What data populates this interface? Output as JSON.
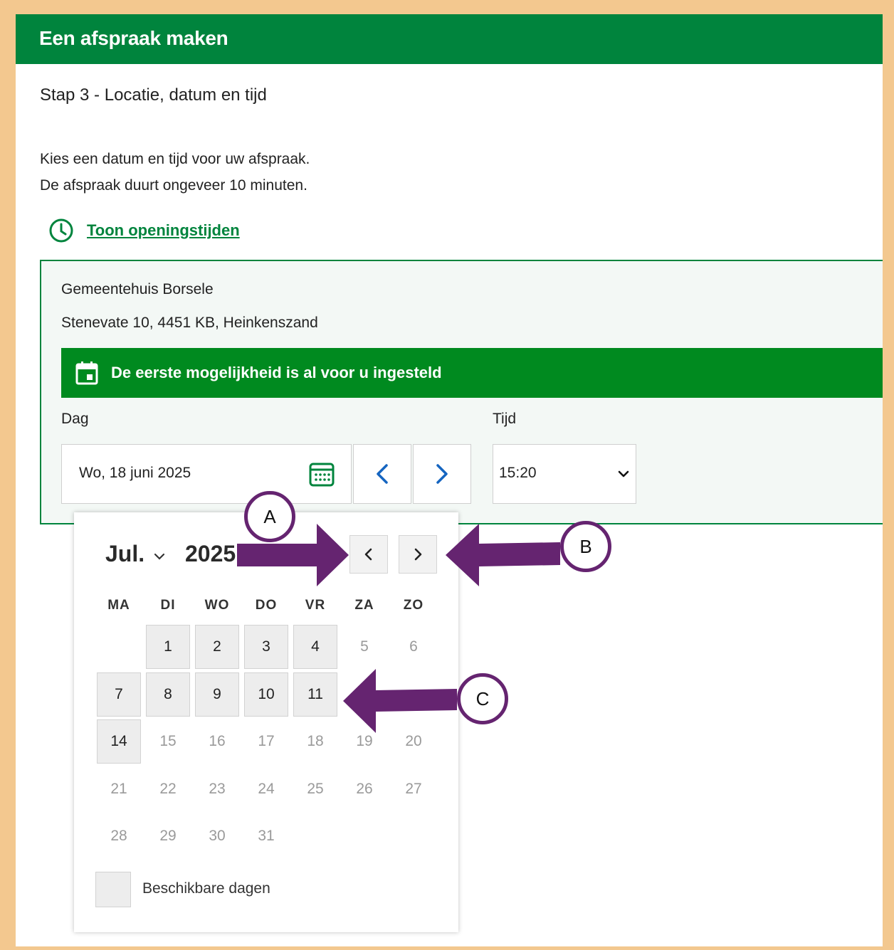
{
  "header": {
    "title": "Een afspraak maken"
  },
  "step_title": "Stap 3 - Locatie, datum en tijd",
  "intro": {
    "line1": "Kies een datum en tijd voor uw afspraak.",
    "line2": "De afspraak duurt ongeveer 10 minuten."
  },
  "hours_link": {
    "label": "Toon openingstijden",
    "icon": "clock-icon"
  },
  "location": {
    "name": "Gemeentehuis Borsele",
    "address": "Stenevate 10, 4451 KB, Heinkenszand"
  },
  "notice": {
    "text": "De eerste mogelijkheid is al voor u ingesteld",
    "icon": "calendar-icon"
  },
  "day_field": {
    "label": "Dag",
    "value": "Wo, 18 juni 2025"
  },
  "time_field": {
    "label": "Tijd",
    "value": "15:20"
  },
  "datepicker": {
    "month": "Jul.",
    "year": "2025",
    "weekdays": [
      "MA",
      "DI",
      "WO",
      "DO",
      "VR",
      "ZA",
      "ZO"
    ],
    "weeks": [
      [
        null,
        {
          "d": "1",
          "a": true
        },
        {
          "d": "2",
          "a": true
        },
        {
          "d": "3",
          "a": true
        },
        {
          "d": "4",
          "a": true
        },
        {
          "d": "5",
          "a": false
        },
        {
          "d": "6",
          "a": false
        }
      ],
      [
        {
          "d": "7",
          "a": true
        },
        {
          "d": "8",
          "a": true
        },
        {
          "d": "9",
          "a": true
        },
        {
          "d": "10",
          "a": true
        },
        {
          "d": "11",
          "a": true
        },
        null,
        null
      ],
      [
        {
          "d": "14",
          "a": true
        },
        {
          "d": "15",
          "a": false
        },
        {
          "d": "16",
          "a": false
        },
        {
          "d": "17",
          "a": false
        },
        {
          "d": "18",
          "a": false
        },
        {
          "d": "19",
          "a": false
        },
        {
          "d": "20",
          "a": false
        }
      ],
      [
        {
          "d": "21",
          "a": false
        },
        {
          "d": "22",
          "a": false
        },
        {
          "d": "23",
          "a": false
        },
        {
          "d": "24",
          "a": false
        },
        {
          "d": "25",
          "a": false
        },
        {
          "d": "26",
          "a": false
        },
        {
          "d": "27",
          "a": false
        }
      ],
      [
        {
          "d": "28",
          "a": false
        },
        {
          "d": "29",
          "a": false
        },
        {
          "d": "30",
          "a": false
        },
        {
          "d": "31",
          "a": false
        },
        null,
        null,
        null
      ]
    ],
    "legend": "Beschikbare dagen"
  },
  "callouts": {
    "a": "A",
    "b": "B",
    "c": "C"
  },
  "colors": {
    "brand_green": "#00843d",
    "notice_green": "#008a1f",
    "annotation_purple": "#652470",
    "frame_orange": "#f3c88f",
    "nav_blue": "#1565c0"
  }
}
